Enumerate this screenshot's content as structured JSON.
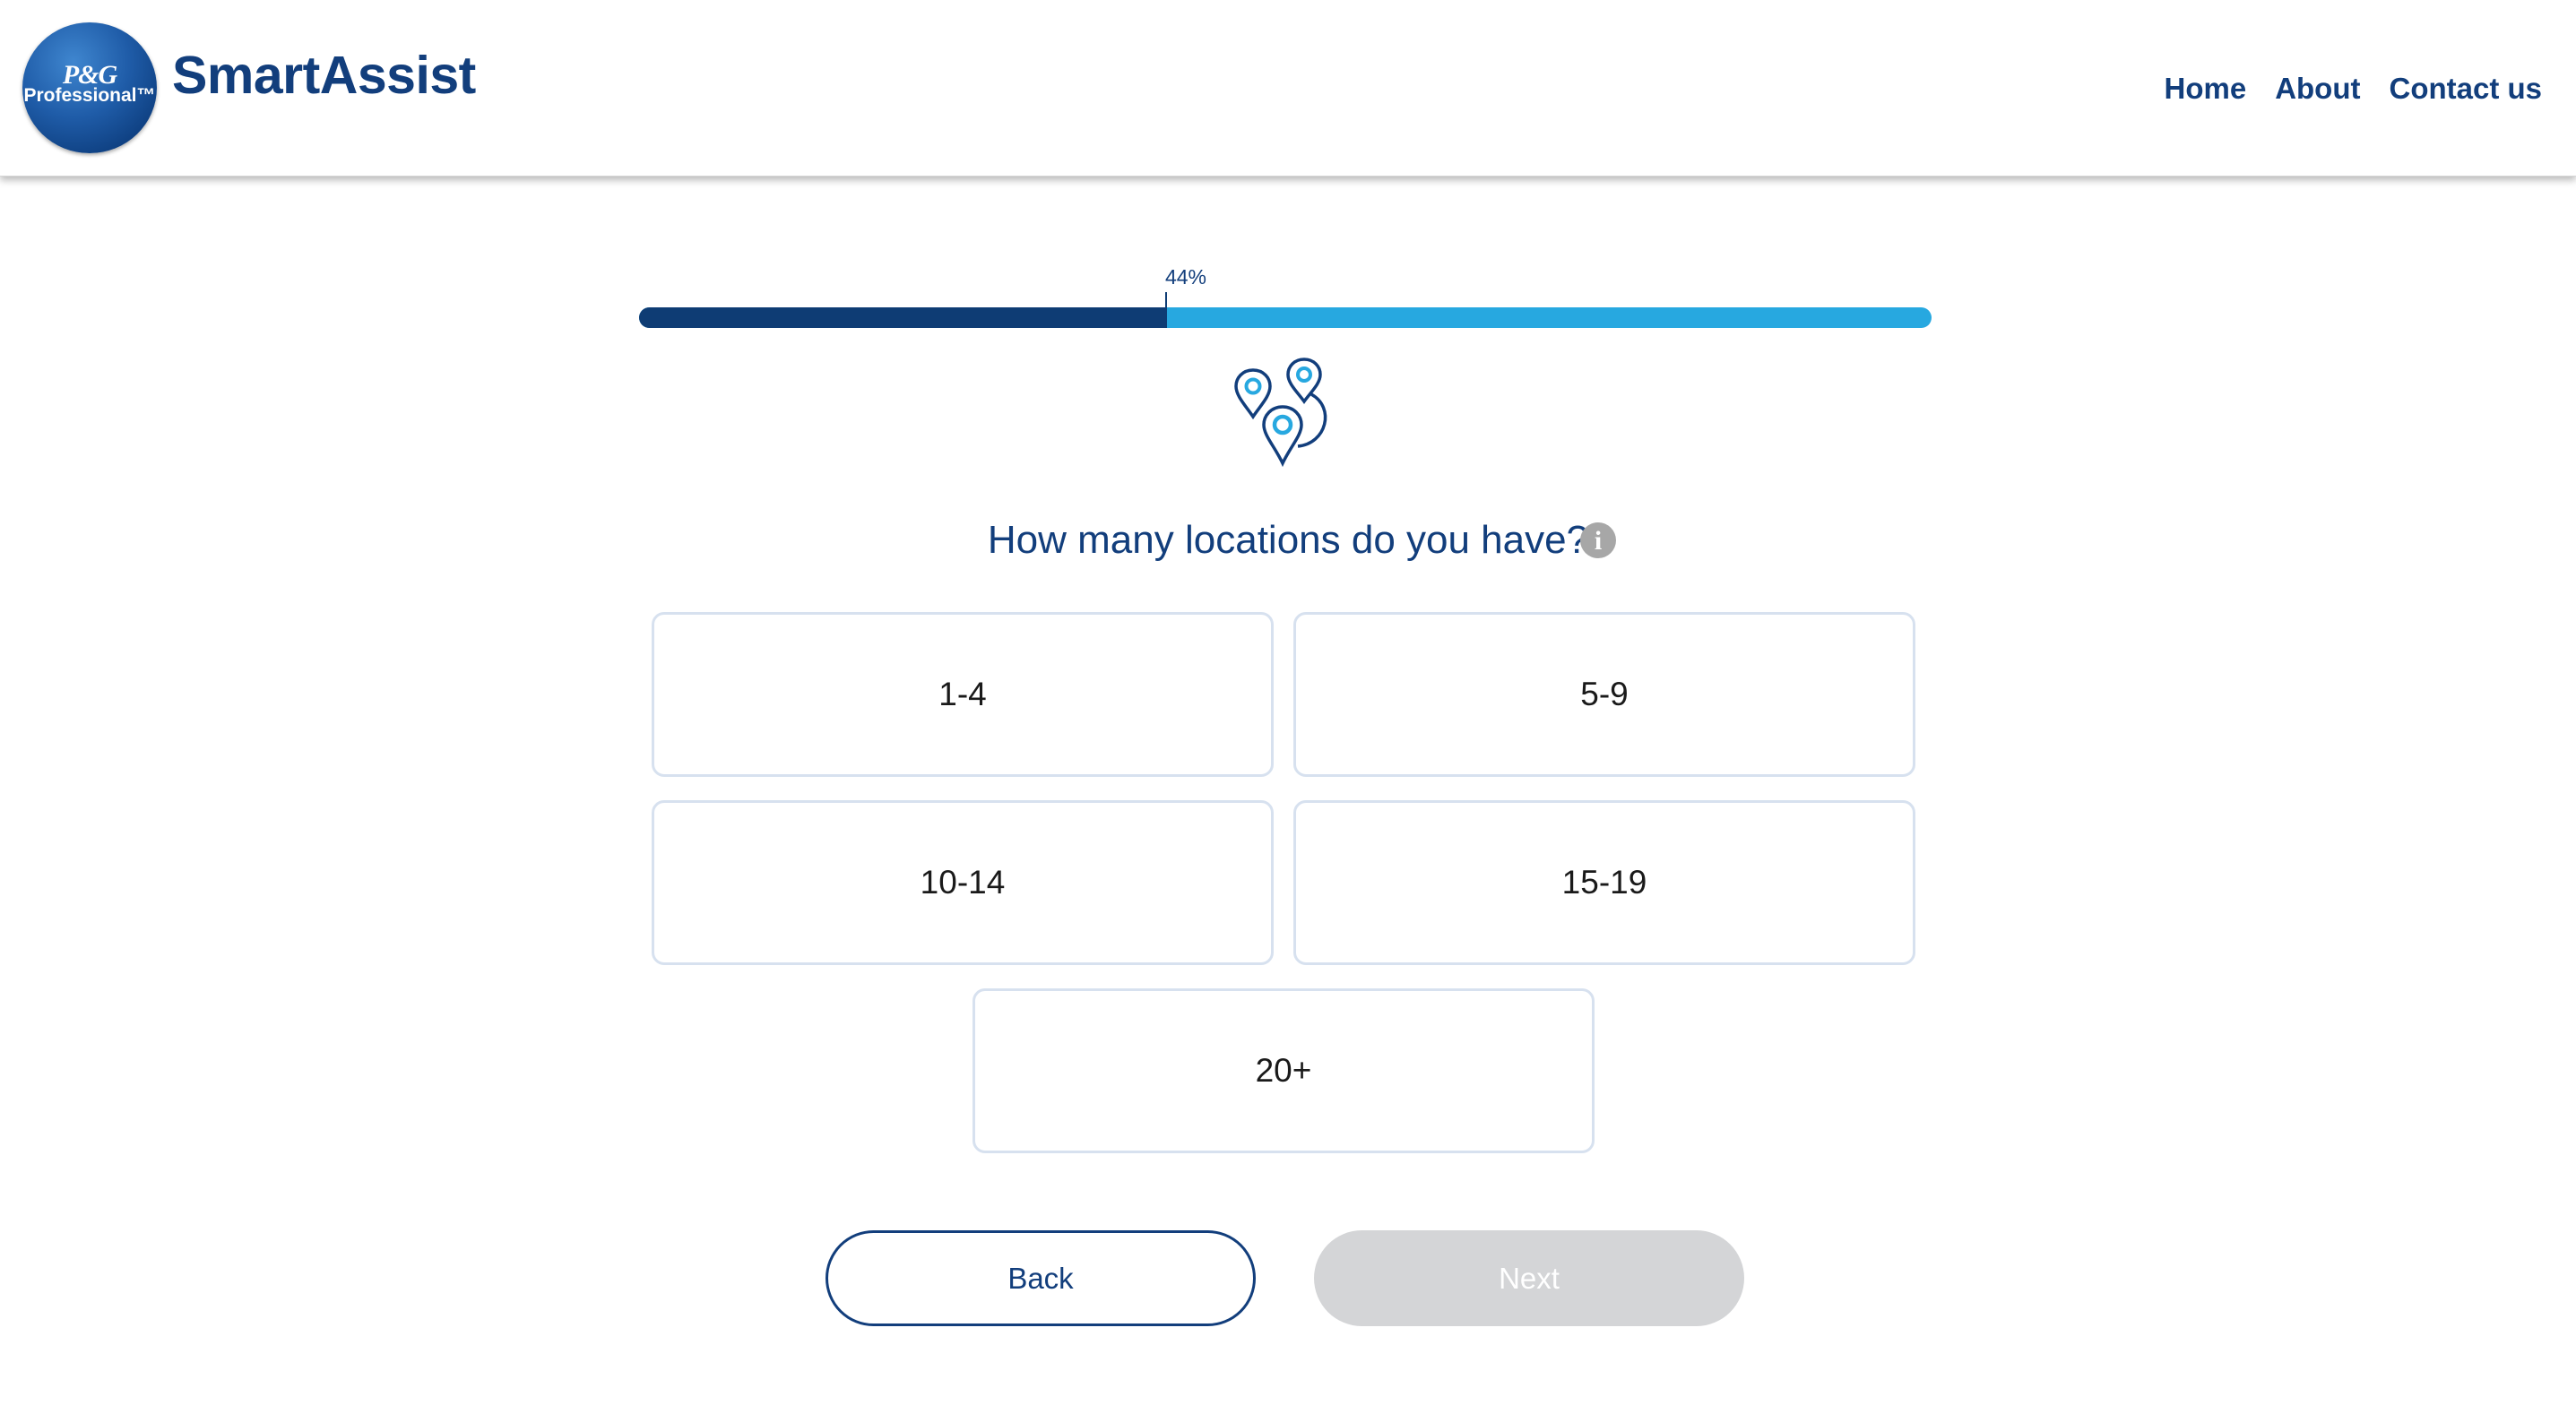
{
  "header": {
    "logo": {
      "line1": "P&G",
      "line2": "Professional™"
    },
    "brand": "SmartAssist",
    "nav": [
      "Home",
      "About",
      "Contact us"
    ]
  },
  "progress": {
    "label": "44%",
    "value": 0.44
  },
  "question": {
    "icon": "location-pins-icon",
    "text": "How many locations do you have?",
    "info_icon": "info-icon"
  },
  "options": [
    "1-4",
    "5-9",
    "10-14",
    "15-19",
    "20+"
  ],
  "actions": {
    "back_label": "Back",
    "next_label": "Next",
    "next_disabled": true
  },
  "colors": {
    "brand_navy": "#123e7c",
    "progress_fill": "#0e3c74",
    "progress_track": "#27a8e0",
    "option_border": "#d7e1ef",
    "disabled_button": "#d4d5d7"
  }
}
